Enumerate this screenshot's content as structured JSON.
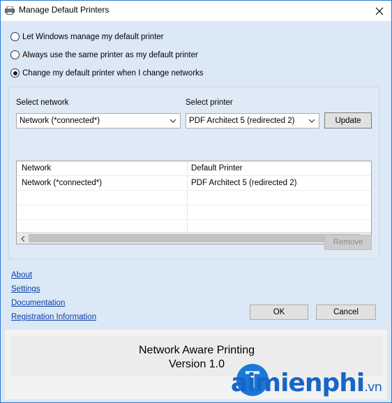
{
  "window": {
    "title": "Manage Default Printers"
  },
  "options": [
    {
      "label": "Let Windows manage my default printer",
      "checked": false
    },
    {
      "label": "Always use the same printer as my default printer",
      "checked": false
    },
    {
      "label": "Change my default printer when I change networks",
      "checked": true
    }
  ],
  "network": {
    "label": "Select network",
    "value": "Network (*connected*)"
  },
  "printer": {
    "label": "Select printer",
    "value": "PDF Architect 5 (redirected 2)"
  },
  "buttons": {
    "update": "Update",
    "remove": "Remove",
    "ok": "OK",
    "cancel": "Cancel"
  },
  "list": {
    "columns": [
      "Network",
      "Default Printer"
    ],
    "rows": [
      [
        "Network (*connected*)",
        "PDF Architect 5 (redirected 2)"
      ]
    ]
  },
  "links": [
    "About",
    "Settings",
    "Documentation",
    "Registration Information"
  ],
  "footer": {
    "name": "Network Aware Printing",
    "version": "Version 1.0"
  },
  "watermark": {
    "brand": "aimienphi",
    "tld": ".vn",
    "logo_letter": "T"
  }
}
